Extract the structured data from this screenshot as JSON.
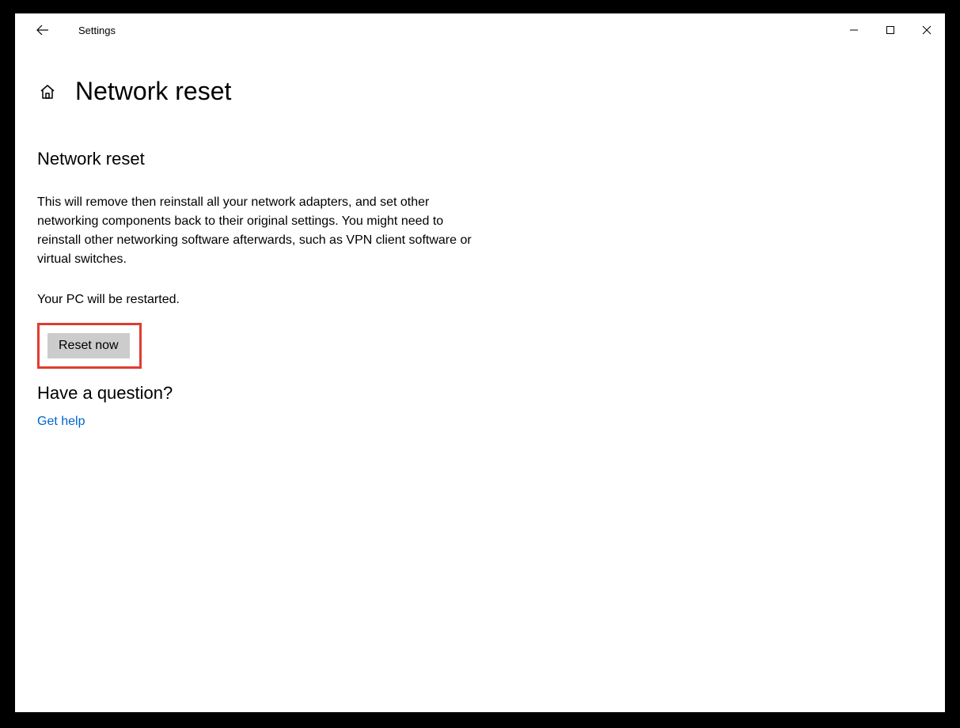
{
  "titlebar": {
    "back_aria": "Back",
    "app_title": "Settings",
    "minimize_aria": "Minimize",
    "maximize_aria": "Maximize",
    "close_aria": "Close"
  },
  "header": {
    "home_aria": "Home",
    "page_title": "Network reset"
  },
  "main": {
    "section_title": "Network reset",
    "description": "This will remove then reinstall all your network adapters, and set other networking components back to their original settings. You might need to reinstall other networking software afterwards, such as VPN client software or virtual switches.",
    "restart_notice": "Your PC will be restarted.",
    "reset_button_label": "Reset now"
  },
  "help": {
    "question_title": "Have a question?",
    "get_help_label": "Get help"
  }
}
